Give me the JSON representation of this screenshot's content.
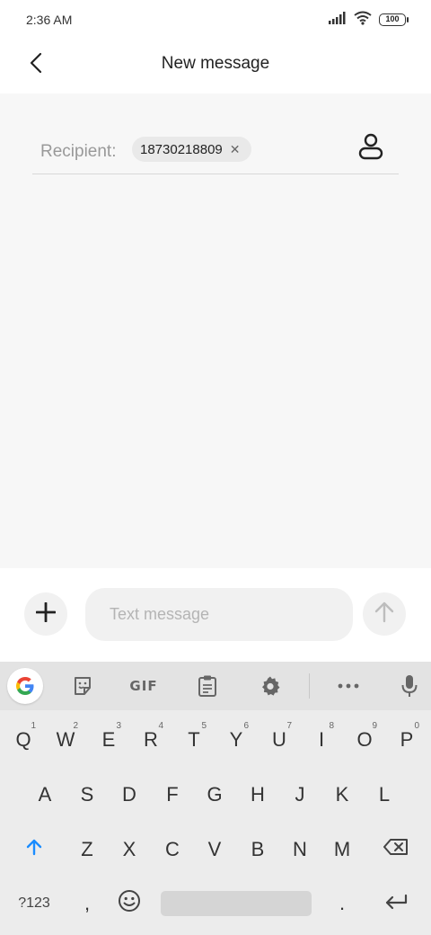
{
  "status_bar": {
    "time": "2:36 AM",
    "battery": "100",
    "icons": [
      "signal-icon",
      "wifi-icon",
      "battery-icon"
    ]
  },
  "header": {
    "title": "New message",
    "back_icon": "back-arrow-icon"
  },
  "recipient": {
    "label": "Recipient:",
    "chips": [
      {
        "number": "18730218809",
        "remove_icon": "close-icon"
      }
    ],
    "contact_icon": "person-icon"
  },
  "compose": {
    "placeholder": "Text message",
    "value": "",
    "add_icon": "plus-icon",
    "send_icon": "send-arrow-icon"
  },
  "keyboard": {
    "toolbar": {
      "items": [
        "google-icon",
        "sticker-icon",
        "GIF",
        "clipboard-icon",
        "settings-icon",
        "more-icon",
        "mic-icon"
      ],
      "gif_label": "GIF"
    },
    "row1": [
      {
        "key": "Q",
        "hint": "1"
      },
      {
        "key": "W",
        "hint": "2"
      },
      {
        "key": "E",
        "hint": "3"
      },
      {
        "key": "R",
        "hint": "4"
      },
      {
        "key": "T",
        "hint": "5"
      },
      {
        "key": "Y",
        "hint": "6"
      },
      {
        "key": "U",
        "hint": "7"
      },
      {
        "key": "I",
        "hint": "8"
      },
      {
        "key": "O",
        "hint": "9"
      },
      {
        "key": "P",
        "hint": "0"
      }
    ],
    "row2": [
      "A",
      "S",
      "D",
      "F",
      "G",
      "H",
      "J",
      "K",
      "L"
    ],
    "row3": [
      "Z",
      "X",
      "C",
      "V",
      "B",
      "N",
      "M"
    ],
    "bottom": {
      "symbols_label": "?123",
      "comma": ",",
      "period": "."
    },
    "colors": {
      "shift_active": "#1a8cff",
      "background": "#ececec",
      "toolbar": "#e3e3e3"
    }
  }
}
